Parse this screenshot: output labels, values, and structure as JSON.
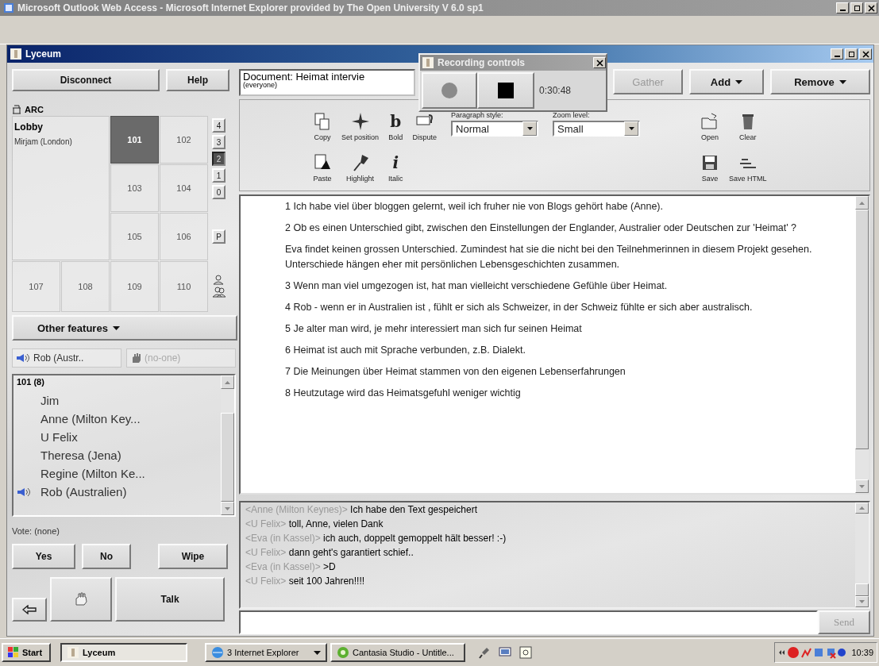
{
  "browser_window": {
    "title": "Microsoft Outlook Web Access - Microsoft Internet Explorer provided by The Open University V 6.0 sp1"
  },
  "app_window": {
    "title": "Lyceum"
  },
  "session_buttons": [
    "Disconnect",
    "Help"
  ],
  "building": "ARC",
  "lobby": {
    "title": "Lobby",
    "occupants": [
      "Mirjam (London)"
    ]
  },
  "rooms": [
    {
      "label": "101",
      "selected": true
    },
    {
      "label": "102",
      "selected": false
    },
    {
      "label": "103",
      "selected": false
    },
    {
      "label": "104",
      "selected": false
    },
    {
      "label": "105",
      "selected": false
    },
    {
      "label": "106",
      "selected": false
    },
    {
      "label": "107",
      "selected": false
    },
    {
      "label": "108",
      "selected": false
    },
    {
      "label": "109",
      "selected": false
    },
    {
      "label": "110",
      "selected": false
    }
  ],
  "floors": [
    {
      "label": "4",
      "selected": false
    },
    {
      "label": "3",
      "selected": false
    },
    {
      "label": "2",
      "selected": true
    },
    {
      "label": "1",
      "selected": false
    },
    {
      "label": "0",
      "selected": false
    },
    {
      "label": "P",
      "selected": false
    }
  ],
  "other_features": {
    "label": "Other features"
  },
  "speaker": {
    "name": "Rob (Austr..",
    "speaking": true
  },
  "floor_holder": {
    "name": "(no-one)",
    "disabled": true
  },
  "participants": {
    "header": "101 (8)",
    "members": [
      {
        "name": "Jim",
        "speaking": false
      },
      {
        "name": "Anne (Milton Key...",
        "speaking": false
      },
      {
        "name": "U Felix",
        "speaking": false
      },
      {
        "name": "Theresa (Jena)",
        "speaking": false
      },
      {
        "name": "Regine (Milton Ke...",
        "speaking": false
      },
      {
        "name": "Rob (Australien)",
        "speaking": true
      }
    ]
  },
  "vote": {
    "label": "Vote: (none)"
  },
  "vote_buttons": [
    "Yes",
    "No",
    "Wipe"
  ],
  "talk_button": "Talk",
  "document": {
    "title": "Document: Heimat intervie",
    "audience": "(everyone)",
    "paragraphs": [
      "1  Ich habe viel über bloggen gelernt, weil ich fruher nie von Blogs gehört habe (Anne).",
      "2  Ob es einen Unterschied gibt, zwischen den Einstellungen der Englander, Australier oder Deutschen zur 'Heimat' ?",
      "Eva findet keinen grossen Unterschied. Zumindest hat sie die nicht bei den Teilnehmerinnen in diesem Projekt gesehen. Unterschiede hängen eher mit persönlichen Lebensgeschichten zusammen.",
      "3 Wenn man viel umgezogen ist, hat man vielleicht verschiedene Gefühle über Heimat.",
      "4 Rob - wenn er in Australien ist , fühlt er sich als Schweizer, in der Schweiz fühlte er sich aber australisch.",
      "5 Je alter man wird, je mehr interessiert man sich fur seinen Heimat",
      "6 Heimat ist auch mit Sprache verbunden, z.B. Dialekt.",
      "7 Die Meinungen über  Heimat stammen von den eigenen Lebenserfahrungen",
      "8  Heutzutage wird das Heimatsgefuhl weniger wichtig"
    ]
  },
  "top_buttons": [
    {
      "label": "Gather",
      "disabled": true,
      "menu": false
    },
    {
      "label": "Add",
      "disabled": false,
      "menu": true
    },
    {
      "label": "Remove",
      "disabled": false,
      "menu": true
    }
  ],
  "edit_tools": [
    {
      "label": "Copy"
    },
    {
      "label": "Set position"
    },
    {
      "label": "Bold",
      "glyph": "b"
    },
    {
      "label": "Dispute"
    },
    {
      "label": "Paste"
    },
    {
      "label": "Highlight"
    },
    {
      "label": "Italic",
      "glyph": "i"
    }
  ],
  "paragraph_style": {
    "label": "Paragraph style:",
    "value": "Normal"
  },
  "zoom_level": {
    "label": "Zoom level:",
    "value": "Small"
  },
  "file_tools": [
    {
      "label": "Open"
    },
    {
      "label": "Clear"
    },
    {
      "label": "Save"
    },
    {
      "label": "Save HTML"
    }
  ],
  "chat": {
    "messages": [
      {
        "sender": "<Anne (Milton Keynes)>",
        "text": "Ich habe  den Text gespeichert"
      },
      {
        "sender": "<U Felix>",
        "text": "toll, Anne, vielen Dank"
      },
      {
        "sender": "<Eva (in Kassel)>",
        "text": "ich auch, doppelt gemoppelt hält besser! :-)"
      },
      {
        "sender": "<U Felix>",
        "text": "dann geht's garantiert schief.."
      },
      {
        "sender": "<Eva (in Kassel)>",
        "text": ">D"
      },
      {
        "sender": "<U Felix>",
        "text": "seit 100 Jahren!!!!"
      }
    ],
    "send": {
      "label": "Send",
      "disabled": true
    }
  },
  "recording": {
    "title": "Recording controls",
    "time": "0:30:48"
  },
  "taskbar": {
    "start": "Start",
    "tasks": [
      {
        "label": "Lyceum",
        "selected": true,
        "group": false
      },
      {
        "label": "3 Internet Explorer",
        "selected": false,
        "group": true
      },
      {
        "label": "Cantasia Studio - Untitle...",
        "selected": false,
        "group": false
      }
    ],
    "clock": "10:39"
  }
}
